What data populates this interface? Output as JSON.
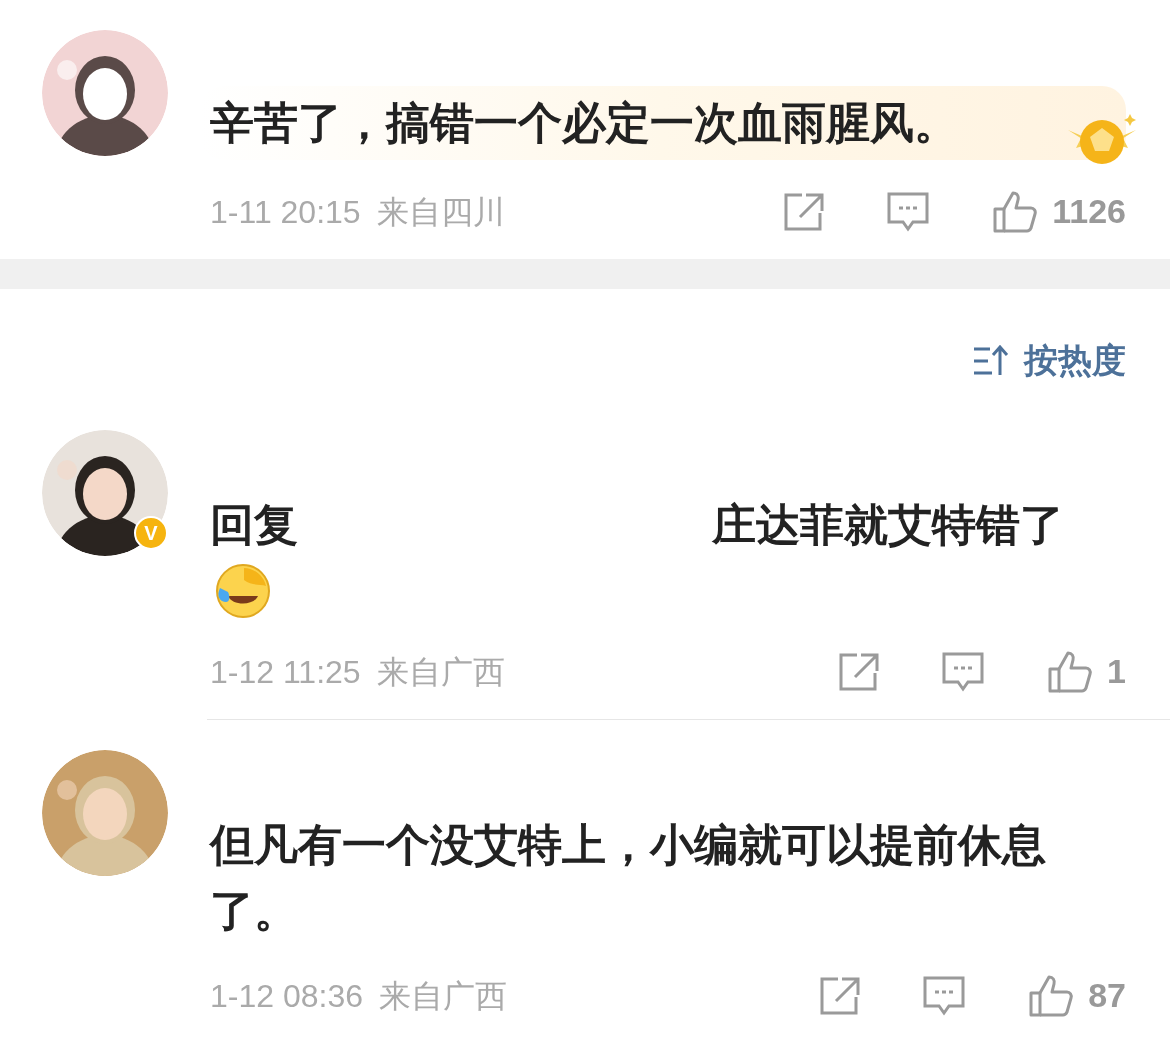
{
  "comments": [
    {
      "avatar": {
        "kind": "picture"
      },
      "highlighted": true,
      "medal": true,
      "text_parts": [
        "辛苦了，搞错一个必定一次血雨腥风。"
      ],
      "emoji": false,
      "time": "1-11 20:15",
      "location": "来自四川",
      "likes": "1126"
    },
    {
      "avatar": {
        "kind": "picture",
        "verified_badge": "V"
      },
      "highlighted": false,
      "medal": false,
      "text_parts": [
        "回复",
        "庄达菲就艾特错了"
      ],
      "emoji": true,
      "time": "1-12 11:25",
      "location": "来自广西",
      "likes": "1"
    },
    {
      "avatar": {
        "kind": "picture"
      },
      "highlighted": false,
      "medal": false,
      "text_parts": [
        "但凡有一个没艾特上，小编就可以提前休息了。"
      ],
      "emoji": false,
      "time": "1-12 08:36",
      "location": "来自广西",
      "likes": "87"
    }
  ],
  "sort": {
    "label": "按热度"
  }
}
